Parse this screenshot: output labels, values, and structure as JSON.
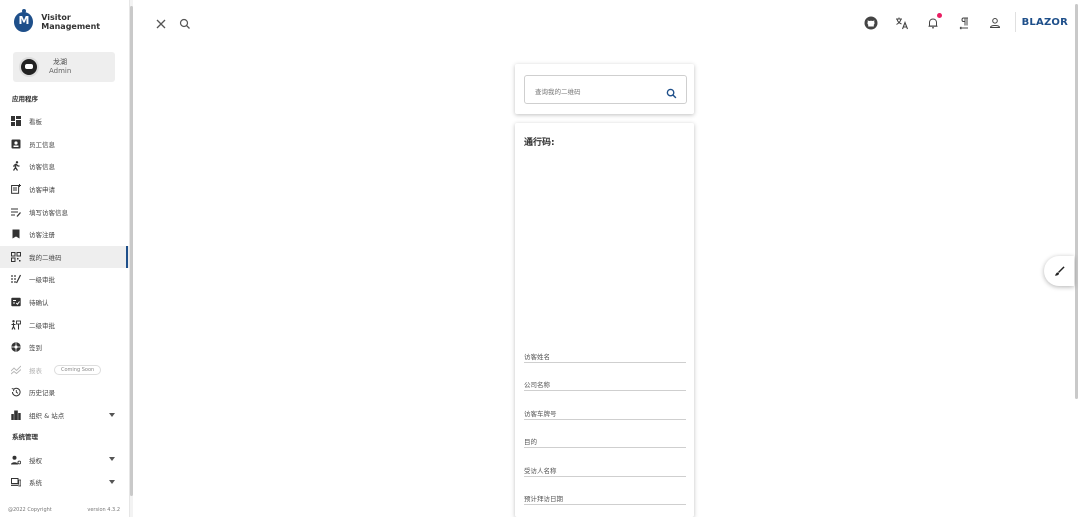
{
  "app": {
    "title": "Visitor Management",
    "brand": "BLAZOR"
  },
  "user": {
    "name": "龙湖",
    "role": "Admin"
  },
  "sidebar": {
    "section_apps": "应用程序",
    "section_system": "系统管理",
    "items": [
      {
        "label": "看板",
        "icon": "dashboard-icon"
      },
      {
        "label": "员工信息",
        "icon": "badge-icon"
      },
      {
        "label": "访客信息",
        "icon": "walk-icon"
      },
      {
        "label": "访客申请",
        "icon": "add-note-icon"
      },
      {
        "label": "填写访客信息",
        "icon": "edit-list-icon"
      },
      {
        "label": "访客注册",
        "icon": "book-icon"
      },
      {
        "label": "我的二维码",
        "icon": "qr-code-icon"
      },
      {
        "label": "一级审批",
        "icon": "approval-icon"
      },
      {
        "label": "待确认",
        "icon": "pending-icon"
      },
      {
        "label": "二级审批",
        "icon": "approval-2-icon"
      },
      {
        "label": "签到",
        "icon": "checkin-icon"
      },
      {
        "label": "报表",
        "icon": "chart-icon",
        "badge": "Coming Soon"
      },
      {
        "label": "历史记录",
        "icon": "history-icon"
      },
      {
        "label": "组织 & 站点",
        "icon": "org-icon"
      }
    ],
    "system_items": [
      {
        "label": "授权",
        "icon": "auth-icon"
      },
      {
        "label": "系统",
        "icon": "system-icon"
      }
    ],
    "footer": {
      "copyright": "@2022 Copyright",
      "version": "version 4.3.2"
    }
  },
  "search": {
    "placeholder": "查询我的二维码"
  },
  "pass": {
    "title": "通行码:",
    "fields": [
      "访客姓名",
      "公司名称",
      "访客车牌号",
      "目的",
      "受访人名称",
      "预计拜访日期"
    ]
  },
  "colors": {
    "accent": "#1e4f8a",
    "notification": "#e91e63"
  }
}
